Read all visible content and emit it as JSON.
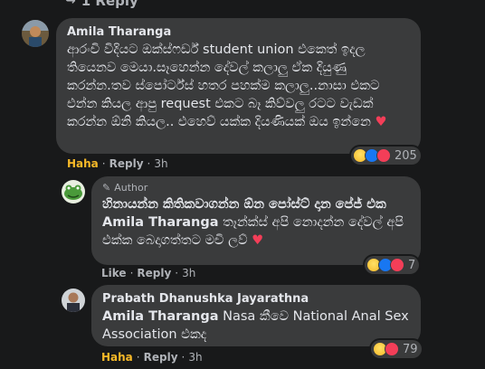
{
  "top_reply": {
    "label": "1 Reply"
  },
  "comments": [
    {
      "name": "Amila Tharanga",
      "text": "ආරංචි විදියට ඔක්ස්ෆර්ඩ් student union එකෙත් ඉදල තියෙනව මෙයා.සෑහෙන්න දේවල් කලාලු ඒක දියුණු කරන්න.තව ස්පෝර්ට්ස් හතර පහක්ම කලාලු..නාසා එකට එන්න කියල ආපු request එකට බෑ කිව්වලු රටට වැඩක් කරන්න ඕනි කියල.. එහෙව් යක්ක දියණියක් ඔය ඉන්නෙ",
      "heart": "♥",
      "actions": {
        "first": "Haha",
        "reply": "Reply",
        "time": "3h"
      },
      "reaction_count": "205"
    },
    {
      "badge": "Author",
      "line1": "හිනායන්න කිතිකවාගන්න ඕන පෝස්ට් දාන පේජ් එක",
      "tag": "Amila Tharanga",
      "line2": " තෑන්ක්ස් අපි නොදන්න දේවල් අපි එක්ක බෙදාගත්තට මචි ලව්",
      "heart": "♥",
      "actions": {
        "first": "Like",
        "reply": "Reply",
        "time": "3h"
      },
      "reaction_count": "7"
    },
    {
      "name": "Prabath Dhanushka Jayarathna",
      "tag": "Amila Tharanga",
      "text": " Nasa කීවෙ National Anal Sex Association එකද",
      "actions": {
        "first": "Haha",
        "reply": "Reply",
        "time": "3h"
      },
      "reaction_count": "79"
    }
  ],
  "colors": {
    "bg": "#18191a",
    "bubble": "#3a3b3c",
    "haha": "#f7b928",
    "love": "#f33e58",
    "like": "#1877f2"
  }
}
